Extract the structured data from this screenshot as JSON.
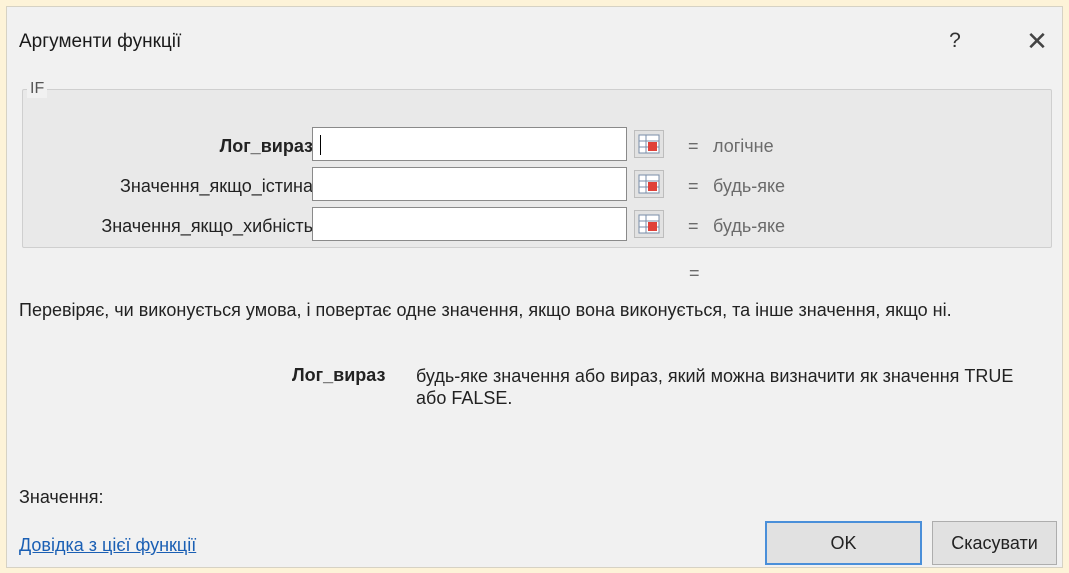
{
  "dialog": {
    "title": "Аргументи функції",
    "help_glyph": "?",
    "close_glyph": "✕",
    "function_name": "IF"
  },
  "arguments": [
    {
      "label": "Лог_вираз",
      "value": "",
      "result": "логічне",
      "bold": true,
      "has_caret": true
    },
    {
      "label": "Значення_якщо_істина",
      "value": "",
      "result": "будь-яке",
      "bold": false,
      "has_caret": false
    },
    {
      "label": "Значення_якщо_хибність",
      "value": "",
      "result": "будь-яке",
      "bold": false,
      "has_caret": false
    }
  ],
  "equals_sign": "=",
  "description": "Перевіряє, чи виконується умова, і повертає одне значення, якщо вона виконується, та інше значення, якщо ні.",
  "argument_help": {
    "name": "Лог_вираз",
    "text": "будь-яке значення або вираз, який можна визначити як значення TRUE або FALSE."
  },
  "value_label": "Значення:",
  "help_link": "Довідка з цієї функції",
  "buttons": {
    "ok": "OK",
    "cancel": "Скасувати"
  },
  "icons": {
    "ref_button": "collapse-dialog-icon"
  },
  "colors": {
    "accent": "#4a8fd9",
    "link": "#1a5fb4",
    "result_text": "#6b6b6b"
  }
}
